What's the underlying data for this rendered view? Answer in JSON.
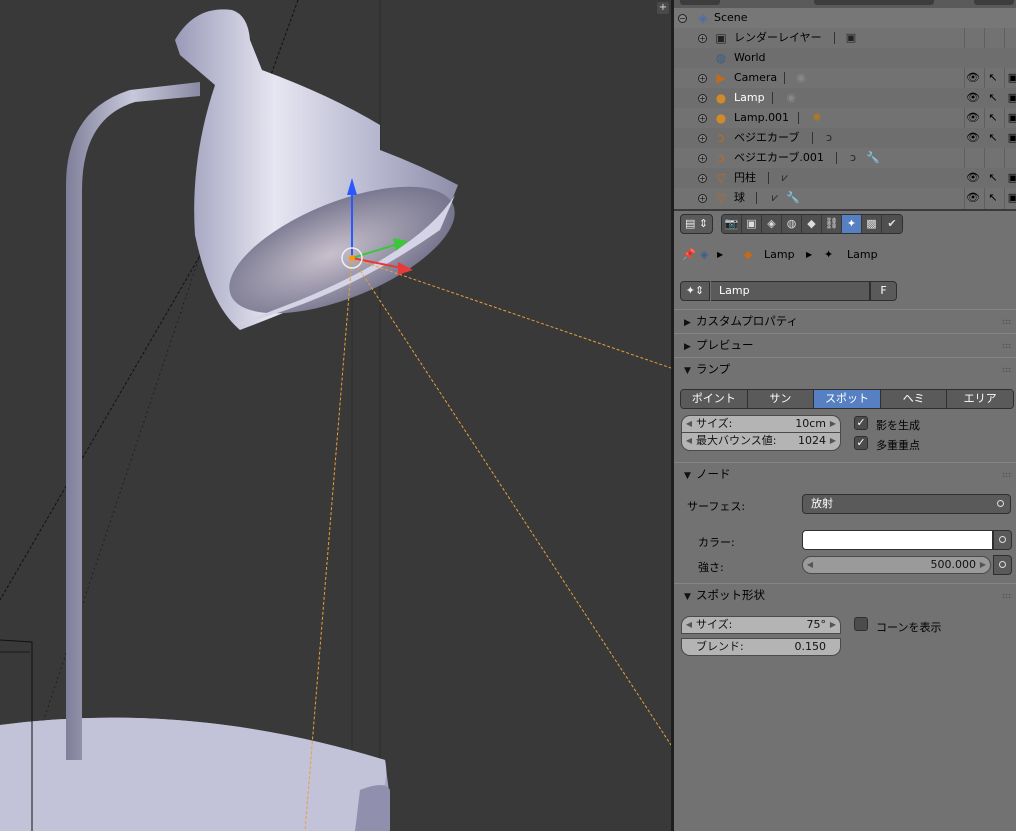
{
  "outliner": {
    "rows": [
      {
        "label": "Scene",
        "icon": "scene-icon"
      },
      {
        "label": "レンダーレイヤー",
        "icon": "render-layers-icon"
      },
      {
        "label": "World",
        "icon": "world-icon"
      },
      {
        "label": "Camera",
        "icon": "camera-object-icon"
      },
      {
        "label": "Lamp",
        "icon": "lamp-object-icon"
      },
      {
        "label": "Lamp.001",
        "icon": "lamp-object-icon"
      },
      {
        "label": "ベジエカーブ",
        "icon": "curve-object-icon"
      },
      {
        "label": "ベジエカーブ.001",
        "icon": "curve-object-icon"
      },
      {
        "label": "円柱",
        "icon": "mesh-object-icon"
      },
      {
        "label": "球",
        "icon": "mesh-object-icon"
      }
    ]
  },
  "properties": {
    "breadcrumb": {
      "object": "Lamp",
      "data": "Lamp"
    },
    "datablock": {
      "name": "Lamp",
      "fake_user": "F"
    },
    "panels": {
      "custom_props": "カスタムプロパティ",
      "preview": "プレビュー",
      "lamp": "ランプ",
      "nodes": "ノード",
      "spot_shape": "スポット形状"
    },
    "lamp_types": [
      "ポイント",
      "サン",
      "スポット",
      "ヘミ",
      "エリア"
    ],
    "active_lamp_type": "スポット",
    "size_label": "サイズ:",
    "size_value": "10cm",
    "max_bounces_label": "最大バウンス値:",
    "max_bounces_value": "1024",
    "cast_shadow": {
      "label": "影を生成",
      "checked": true
    },
    "multiple_importance": {
      "label": "多重重点",
      "checked": true
    },
    "surface_label": "サーフェス:",
    "surface_value": "放射",
    "color_label": "カラー:",
    "color_value": "#ffffff",
    "strength_label": "強さ:",
    "strength_value": "500.000",
    "spot_size_label": "サイズ:",
    "spot_size_value": "75°",
    "show_cone": {
      "label": "コーンを表示",
      "checked": false
    },
    "blend_label": "ブレンド:",
    "blend_value": "0.150"
  },
  "colors": {
    "viewport_bg": "#393939",
    "panel_bg": "#727272",
    "active_blue": "#5680c2",
    "spot_cone_line": "#e8a03c"
  }
}
